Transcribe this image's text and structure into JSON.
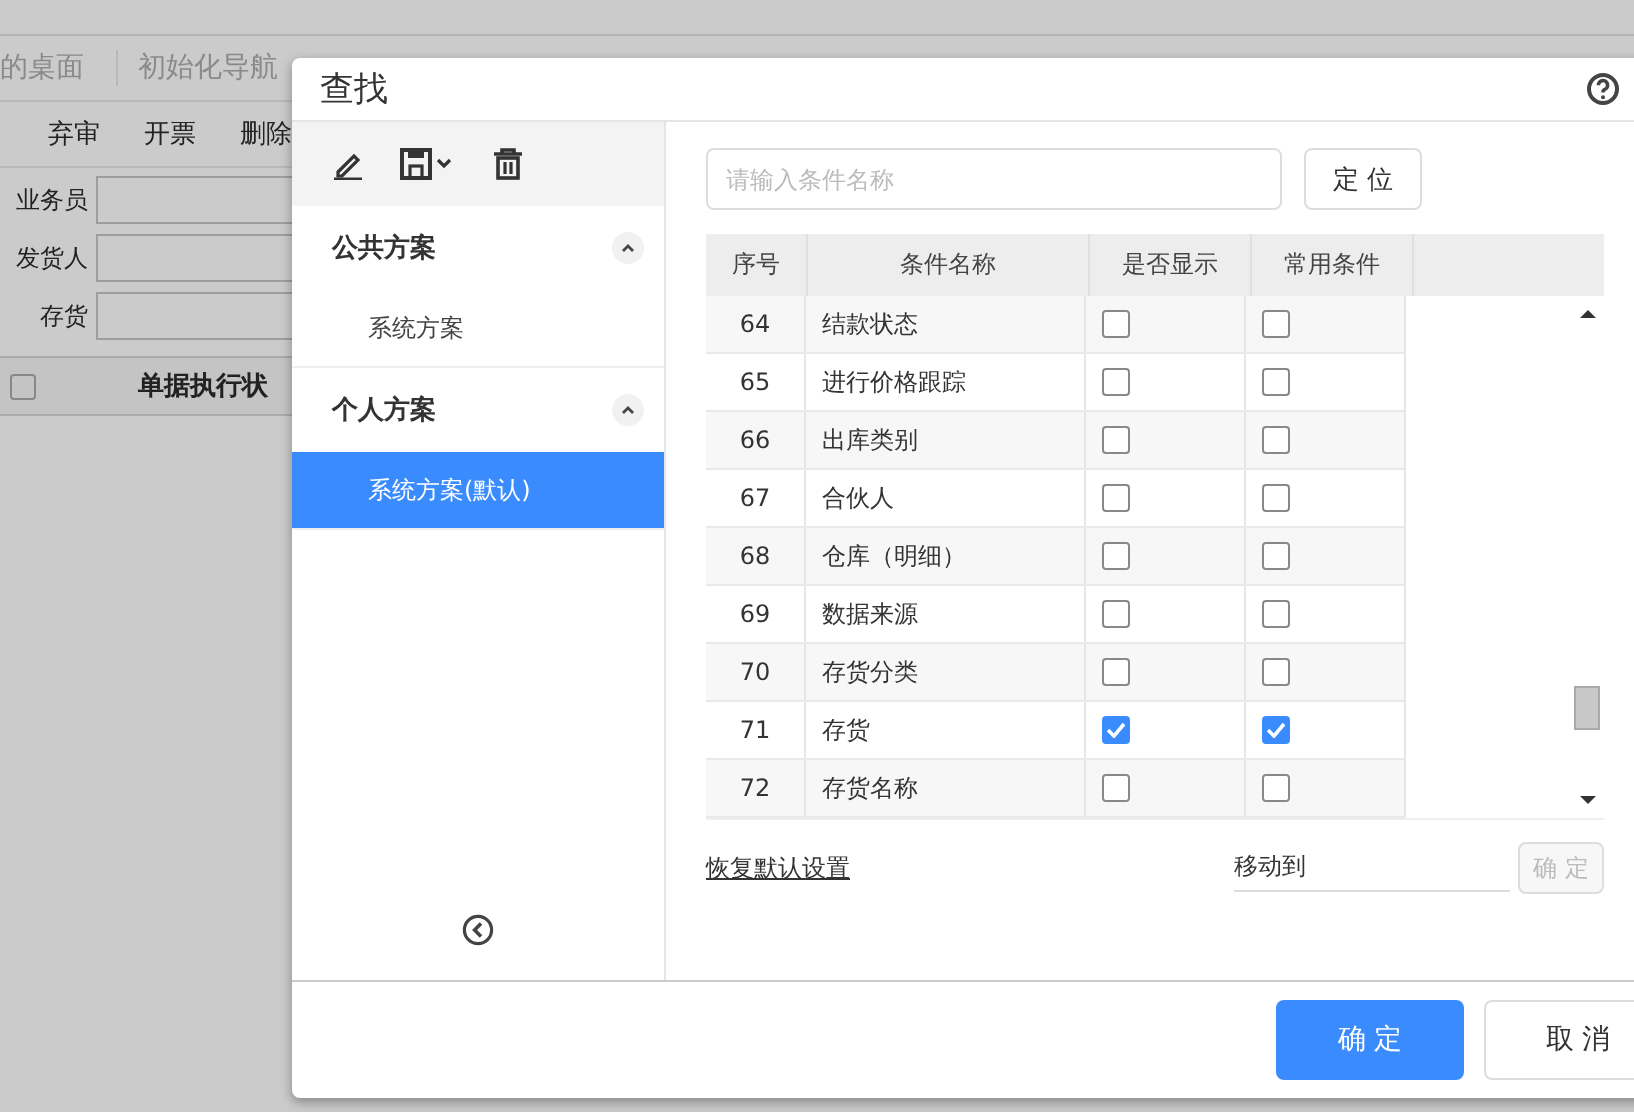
{
  "background": {
    "nav_tabs": [
      "的桌面",
      "初始化导航"
    ],
    "toolbar": [
      "弃审",
      "开票",
      "删除"
    ],
    "filters": [
      {
        "label": "业务员"
      },
      {
        "label": "发货人"
      },
      {
        "label": "存货"
      }
    ],
    "grid_header": "单据执行状",
    "select_all": {
      "checked": false
    }
  },
  "dialog": {
    "title": "查找",
    "groups": [
      {
        "title": "公共方案",
        "expanded": true,
        "items": [
          {
            "label": "系统方案",
            "selected": false
          }
        ]
      },
      {
        "title": "个人方案",
        "expanded": true,
        "items": [
          {
            "label": "系统方案(默认)",
            "selected": true
          }
        ]
      }
    ],
    "search": {
      "placeholder": "请输入条件名称"
    },
    "locate_button": "定 位",
    "table": {
      "columns": [
        "序号",
        "条件名称",
        "是否显示",
        "常用条件"
      ],
      "rows": [
        {
          "no": "64",
          "name": "结款状态",
          "shown": false,
          "common": false
        },
        {
          "no": "65",
          "name": "进行价格跟踪",
          "shown": false,
          "common": false
        },
        {
          "no": "66",
          "name": "出库类别",
          "shown": false,
          "common": false
        },
        {
          "no": "67",
          "name": "合伙人",
          "shown": false,
          "common": false
        },
        {
          "no": "68",
          "name": "仓库（明细）",
          "shown": false,
          "common": false
        },
        {
          "no": "69",
          "name": "数据来源",
          "shown": false,
          "common": false
        },
        {
          "no": "70",
          "name": "存货分类",
          "shown": false,
          "common": false
        },
        {
          "no": "71",
          "name": "存货",
          "shown": true,
          "common": true
        },
        {
          "no": "72",
          "name": "存货名称",
          "shown": false,
          "common": false
        }
      ]
    },
    "restore_link": "恢复默认设置",
    "move_to": {
      "value": "移动到"
    },
    "move_confirm": {
      "label": "确 定",
      "disabled": true
    },
    "buttons": [
      {
        "label": "确 定",
        "kind": "primary"
      },
      {
        "label": "取 消",
        "kind": "secondary"
      }
    ]
  }
}
